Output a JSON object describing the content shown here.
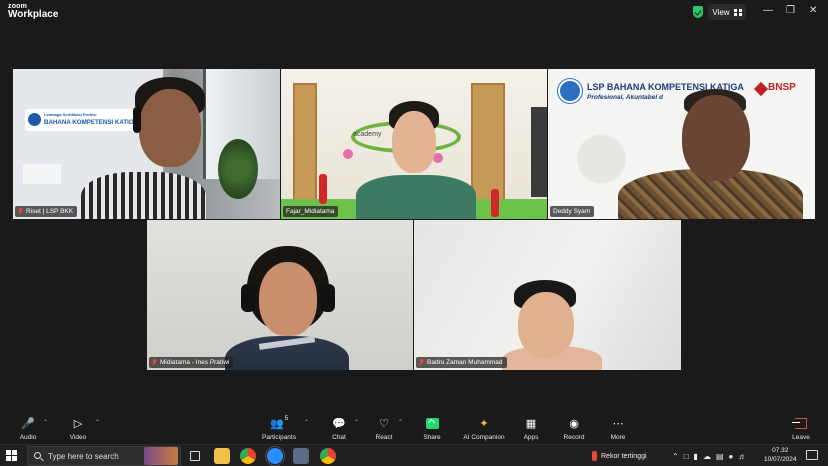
{
  "titlebar": {
    "brand_top": "zoom",
    "brand_bottom": "Workplace",
    "view_label": "View"
  },
  "participants": [
    {
      "name": "Riset | LSP BKK",
      "muted": true
    },
    {
      "name": "Fajar_Midiatama",
      "muted": false
    },
    {
      "name": "Deddy Syam",
      "muted": false,
      "active_speaker": true
    },
    {
      "name": "Midiatama - Ines Pratiwi",
      "muted": true
    },
    {
      "name": "Badru Zaman Muhammad",
      "muted": true
    }
  ],
  "backgrounds": {
    "tile1_banner_small": "Lembaga Sertifikasi Profesi",
    "tile1_banner": "BAHANA KOMPETENSI KATIGA",
    "tile2_wall": "academy",
    "tile3_title": "LSP BAHANA KOMPETENSI KATIGA",
    "tile3_subtitle": "Profesional, Akuntabel d",
    "tile3_logo": "BNSP"
  },
  "toolbar": {
    "audio": "Audio",
    "video": "Video",
    "participants": "Participants",
    "participants_count": "5",
    "chat": "Chat",
    "react": "React",
    "share": "Share",
    "ai_companion": "AI Companion",
    "apps": "Apps",
    "record": "Record",
    "more": "More",
    "leave": "Leave"
  },
  "taskbar": {
    "search_placeholder": "Type here to search",
    "weather": "Rekor tertinggi",
    "time": "07.32",
    "date": "10/07/2024"
  },
  "colors": {
    "active_speaker": "#23d96c",
    "share": "#23d96c",
    "leave": "#e8473c"
  }
}
